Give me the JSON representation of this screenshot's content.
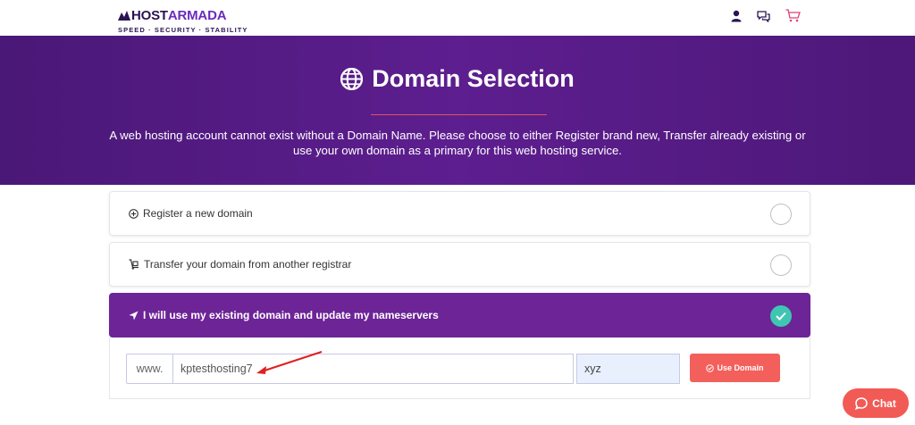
{
  "brand": {
    "name_part1": "HOST",
    "name_part2": "ARMADA",
    "tagline": "SPEED · SECURITY · STABILITY",
    "color_dark": "#2b1452",
    "color_accent": "#6a2bbd"
  },
  "header_icons": [
    "user-icon",
    "chat-bubbles-icon",
    "cart-icon"
  ],
  "hero": {
    "title": "Domain Selection",
    "icon": "globe-icon",
    "description": "A web hosting account cannot exist without a Domain Name. Please choose to either Register brand new, Transfer already existing or use your own domain as a primary for this web hosting service.",
    "bg_color": "#5d1e8f",
    "divider_color": "#e05460"
  },
  "options": [
    {
      "label": "Register a new domain",
      "icon": "plus-circle-icon",
      "selected": false
    },
    {
      "label": "Transfer your domain from another registrar",
      "icon": "dolly-icon",
      "selected": false
    },
    {
      "label": "I will use my existing domain and update my nameservers",
      "icon": "location-arrow-icon",
      "selected": true
    }
  ],
  "domain_form": {
    "prefix": "www.",
    "domain_value": "kptesthosting7",
    "tld_value": "xyz",
    "button_label": "Use Domain",
    "button_color": "#f3605c"
  },
  "chat": {
    "label": "Chat",
    "color": "#f25a55"
  }
}
